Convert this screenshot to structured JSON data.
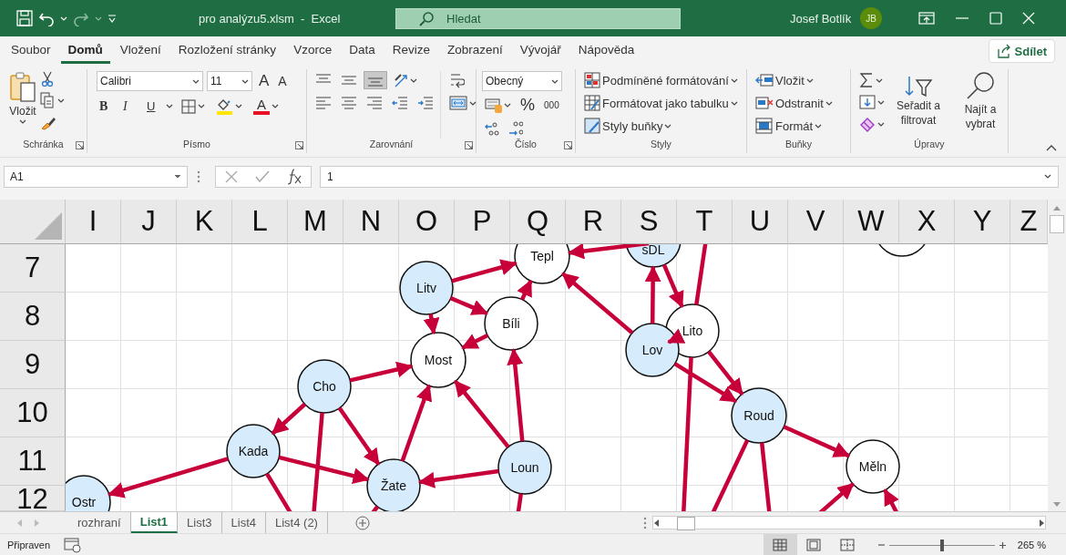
{
  "window": {
    "title": "pro analýzu5.xlsm  -  Excel",
    "search_placeholder": "Hledat",
    "user": "Josef Botlík",
    "initials": "JB"
  },
  "menu_tabs": [
    {
      "label": "Soubor",
      "selected": false
    },
    {
      "label": "Domů",
      "selected": true
    },
    {
      "label": "Vložení",
      "selected": false
    },
    {
      "label": "Rozložení stránky",
      "selected": false
    },
    {
      "label": "Vzorce",
      "selected": false
    },
    {
      "label": "Data",
      "selected": false
    },
    {
      "label": "Revize",
      "selected": false
    },
    {
      "label": "Zobrazení",
      "selected": false
    },
    {
      "label": "Vývojář",
      "selected": false
    },
    {
      "label": "Nápověda",
      "selected": false
    }
  ],
  "share_button": "Sdílet",
  "ribbon": {
    "clipboard": {
      "paste": "Vložit",
      "label": "Schránka"
    },
    "font": {
      "name": "Calibri",
      "size": "11",
      "grow": "A",
      "shrink": "A",
      "bold": "B",
      "italic": "I",
      "underline": "U",
      "font_color": "A",
      "label": "Písmo"
    },
    "alignment": {
      "label": "Zarovnání",
      "vertical": [
        {
          "kind": "top",
          "selected": false
        },
        {
          "kind": "middle",
          "selected": false
        },
        {
          "kind": "bottom",
          "selected": true
        }
      ]
    },
    "number": {
      "format": "Obecný",
      "percent": "%",
      "thousands": "000",
      "label": "Číslo"
    },
    "styles": {
      "items": [
        "Podmíněné formátování",
        "Formátovat jako tabulku",
        "Styly buňky"
      ],
      "label": "Styly"
    },
    "cells": {
      "items": [
        "Vložit",
        "Odstranit",
        "Formát"
      ],
      "label": "Buňky"
    },
    "editing": {
      "sort": "Seřadit a filtrovat",
      "find": "Najít a vybrat",
      "label": "Úpravy"
    }
  },
  "formula_bar": {
    "name_box": "A1",
    "value": "1"
  },
  "columns": [
    "I",
    "J",
    "K",
    "L",
    "M",
    "N",
    "O",
    "P",
    "Q",
    "R",
    "S",
    "T",
    "U",
    "V",
    "W",
    "X",
    "Y",
    "Z"
  ],
  "rows": [
    "7",
    "8",
    "9",
    "10",
    "11",
    "12"
  ],
  "diagram": {
    "nodes": [
      {
        "label": "Tepl",
        "highlighted": false
      },
      {
        "label": "sDL",
        "highlighted": true
      },
      {
        "highlighted": false
      },
      {
        "label": "Litv",
        "highlighted": true
      },
      {
        "label": "Bíli",
        "highlighted": false
      },
      {
        "label": "Most",
        "highlighted": false
      },
      {
        "label": "Lito",
        "highlighted": false
      },
      {
        "label": "Lov",
        "highlighted": true
      },
      {
        "label": "Cho",
        "highlighted": true
      },
      {
        "label": "Roud",
        "highlighted": true
      },
      {
        "label": "Kada",
        "highlighted": true
      },
      {
        "label": "Loun",
        "highlighted": true
      },
      {
        "label": "Měln",
        "highlighted": false
      },
      {
        "label": "Žate",
        "highlighted": true
      },
      {
        "label": "Ostr",
        "highlighted": true
      }
    ]
  },
  "sheet_tabs": [
    {
      "label": "rozhraní",
      "selected": false
    },
    {
      "label": "List1",
      "selected": true
    },
    {
      "label": "List3",
      "selected": false
    },
    {
      "label": "List4",
      "selected": false
    },
    {
      "label": "List4 (2)",
      "selected": false
    }
  ],
  "status_bar": {
    "status": "Připraven",
    "view_buttons": [
      {
        "kind": "normal",
        "selected": true
      },
      {
        "kind": "page_layout",
        "selected": false
      },
      {
        "kind": "page_break",
        "selected": false
      }
    ],
    "zoom_slider": {
      "level": 0.5
    },
    "zoom": "265 %"
  }
}
